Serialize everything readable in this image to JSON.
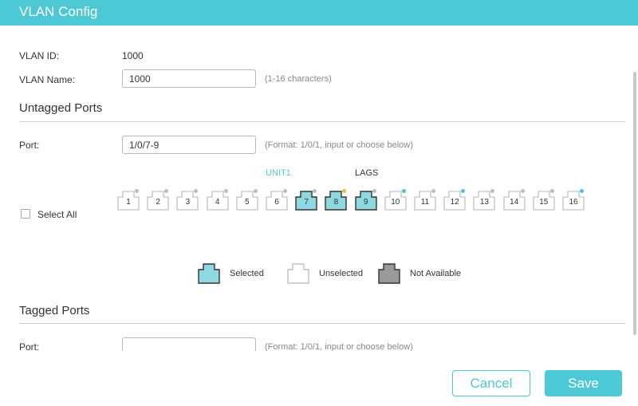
{
  "window": {
    "title": "VLAN Config"
  },
  "vlan": {
    "id_label": "VLAN ID:",
    "id_value": "1000",
    "name_label": "VLAN Name:",
    "name_value": "1000",
    "name_hint": "(1-16 characters)"
  },
  "untagged": {
    "section_title": "Untagged Ports",
    "port_label": "Port:",
    "port_value": "1/0/7-9",
    "port_hint": "(Format: 1/0/1, input or choose below)",
    "unit_label": "UNIT1",
    "lags_label": "LAGS",
    "select_all_label": "Select All",
    "ports": [
      {
        "num": "1",
        "state": "unselected",
        "indicator": "gray"
      },
      {
        "num": "2",
        "state": "unselected",
        "indicator": "gray"
      },
      {
        "num": "3",
        "state": "unselected",
        "indicator": "gray"
      },
      {
        "num": "4",
        "state": "unselected",
        "indicator": "gray"
      },
      {
        "num": "5",
        "state": "unselected",
        "indicator": "gray"
      },
      {
        "num": "6",
        "state": "unselected",
        "indicator": "gray"
      },
      {
        "num": "7",
        "state": "selected",
        "indicator": "gray"
      },
      {
        "num": "8",
        "state": "selected",
        "indicator": "orange"
      },
      {
        "num": "9",
        "state": "selected",
        "indicator": "gray"
      },
      {
        "num": "10",
        "state": "unselected",
        "indicator": "blue"
      },
      {
        "num": "11",
        "state": "unselected",
        "indicator": "gray"
      },
      {
        "num": "12",
        "state": "unselected",
        "indicator": "blue"
      },
      {
        "num": "13",
        "state": "unselected",
        "indicator": "gray"
      },
      {
        "num": "14",
        "state": "unselected",
        "indicator": "gray"
      },
      {
        "num": "15",
        "state": "unselected",
        "indicator": "gray"
      },
      {
        "num": "16",
        "state": "unselected",
        "indicator": "blue"
      }
    ]
  },
  "legend": {
    "selected": "Selected",
    "unselected": "Unselected",
    "not_available": "Not Available"
  },
  "tagged": {
    "section_title": "Tagged Ports",
    "port_label": "Port:",
    "port_value": "",
    "port_hint": "(Format: 1/0/1, input or choose below)"
  },
  "buttons": {
    "cancel": "Cancel",
    "save": "Save"
  },
  "colors": {
    "accent": "#4dc9d6",
    "selected_fill": "#8ed9e1",
    "not_available_fill": "#9a9a9a",
    "indicator_gray": "#bdbdbd",
    "indicator_orange": "#f5b731",
    "indicator_blue": "#45c4e0"
  }
}
